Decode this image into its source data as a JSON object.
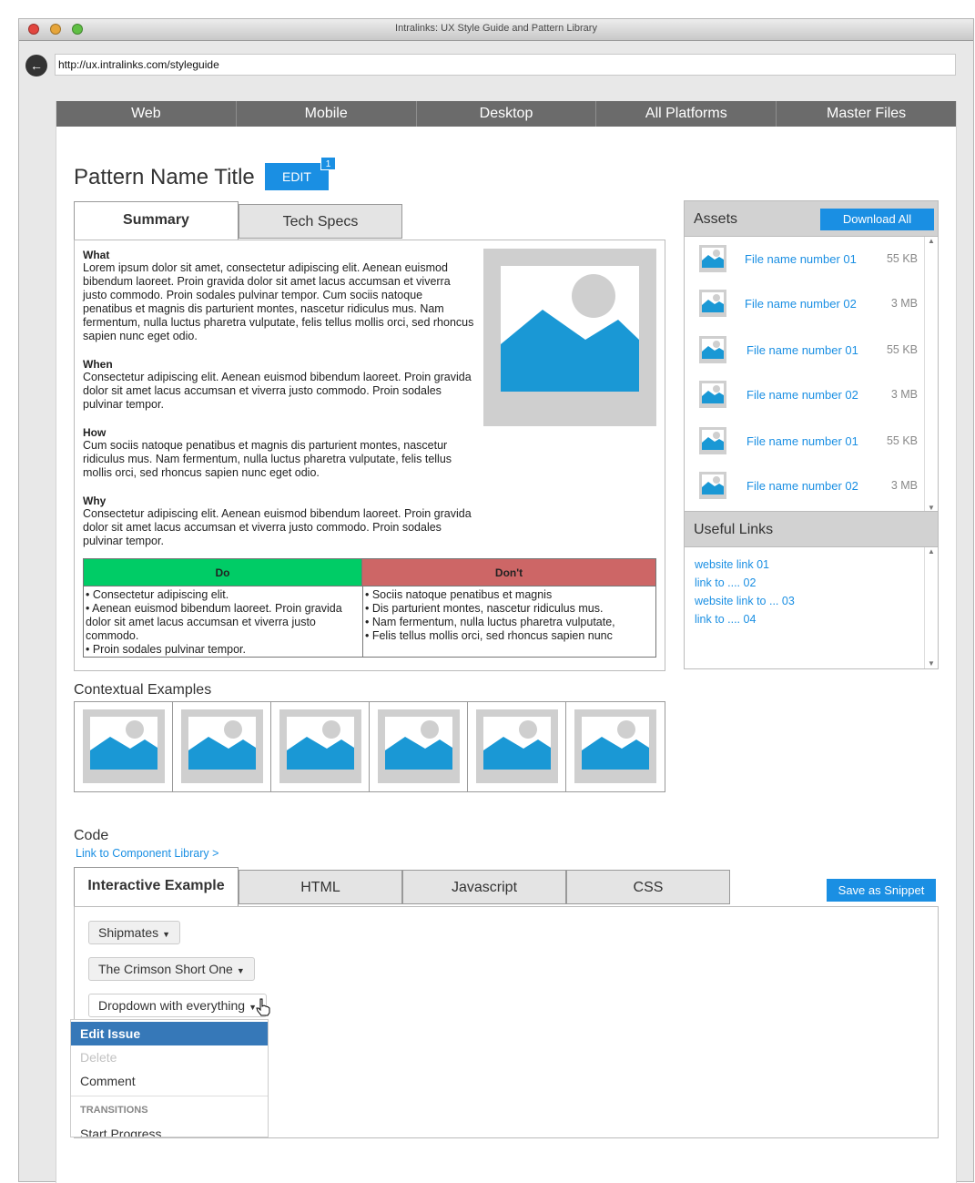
{
  "window": {
    "title": "Intralinks: UX Style Guide and Pattern Library"
  },
  "address_bar": {
    "url": "http://ux.intralinks.com/styleguide"
  },
  "platform_nav": [
    {
      "label": "Web"
    },
    {
      "label": "Mobile"
    },
    {
      "label": "Desktop"
    },
    {
      "label": "All Platforms"
    },
    {
      "label": "Master Files"
    }
  ],
  "pattern": {
    "title": "Pattern Name Title",
    "edit_label": "EDIT",
    "edit_badge": "1"
  },
  "detail_tabs": [
    {
      "label": "Summary",
      "active": true
    },
    {
      "label": "Tech Specs",
      "active": false
    }
  ],
  "summary": {
    "sections": [
      {
        "heading": "What",
        "body": "Lorem ipsum dolor sit amet, consectetur adipiscing elit. Aenean euismod bibendum laoreet. Proin gravida dolor sit amet lacus accumsan et viverra justo commodo. Proin sodales pulvinar tempor. Cum sociis natoque penatibus et magnis dis parturient montes, nascetur ridiculus mus. Nam fermentum, nulla luctus pharetra vulputate, felis tellus mollis orci, sed rhoncus sapien nunc eget odio."
      },
      {
        "heading": "When",
        "body": "Consectetur adipiscing elit. Aenean euismod bibendum laoreet. Proin gravida dolor sit amet lacus accumsan et viverra justo commodo. Proin sodales pulvinar tempor."
      },
      {
        "heading": "How",
        "body": "Cum sociis natoque penatibus et magnis dis parturient montes, nascetur ridiculus mus. Nam fermentum, nulla luctus pharetra vulputate, felis tellus mollis orci, sed rhoncus sapien nunc eget odio."
      },
      {
        "heading": "Why",
        "body": "Consectetur adipiscing elit. Aenean euismod bibendum laoreet. Proin gravida dolor sit amet lacus accumsan et viverra justo commodo. Proin sodales pulvinar tempor."
      }
    ],
    "do_dont": {
      "do_label": "Do",
      "dont_label": "Don't",
      "do_color": "#00cc66",
      "dont_color": "#cd6666",
      "do_items": [
        "• Consectetur adipiscing elit.",
        "• Aenean euismod bibendum laoreet. Proin gravida dolor sit amet lacus accumsan et viverra justo commodo.",
        "• Proin sodales pulvinar tempor."
      ],
      "dont_items": [
        "• Sociis natoque penatibus et magnis",
        "• Dis parturient montes, nascetur ridiculus mus.",
        "• Nam fermentum, nulla luctus pharetra vulputate,",
        "• Felis tellus mollis orci, sed rhoncus sapien nunc"
      ]
    }
  },
  "assets": {
    "title": "Assets",
    "download_all": "Download All",
    "files": [
      {
        "name": "File name number 01",
        "size": "55 KB"
      },
      {
        "name": "File name number 02",
        "size": "3 MB"
      },
      {
        "name": "File name number 01",
        "size": "55 KB"
      },
      {
        "name": "File name number 02",
        "size": "3 MB"
      },
      {
        "name": "File name number 01",
        "size": "55 KB"
      },
      {
        "name": "File name number 02",
        "size": "3 MB"
      }
    ]
  },
  "useful_links": {
    "title": "Useful Links",
    "links": [
      "website link 01",
      "link to .... 02",
      "website link to ... 03",
      "link to .... 04"
    ]
  },
  "contextual_examples": {
    "title": "Contextual Examples",
    "count": 6
  },
  "code": {
    "title": "Code",
    "component_link": "Link to Component Library >",
    "save_snippet": "Save as Snippet",
    "tabs": [
      {
        "label": "Interactive Example",
        "active": true
      },
      {
        "label": "HTML",
        "active": false
      },
      {
        "label": "Javascript",
        "active": false
      },
      {
        "label": "CSS",
        "active": false
      }
    ],
    "dropdowns": [
      "Shipmates",
      "The Crimson Short One",
      "Dropdown with everything"
    ],
    "menu": {
      "items": [
        {
          "label": "Edit Issue",
          "state": "selected"
        },
        {
          "label": "Delete",
          "state": "disabled"
        },
        {
          "label": "Comment",
          "state": "normal"
        }
      ],
      "group_label": "TRANSITIONS",
      "group_items": [
        "Start Progress"
      ]
    }
  },
  "colors": {
    "accent": "#1a8fe3",
    "nav_bg": "#6b6b6b",
    "menu_selected": "#3678b8",
    "image_blue": "#1a98d5",
    "image_gray": "#cfcfcf"
  },
  "icons": [
    "back-arrow-icon",
    "image-placeholder-icon",
    "caret-down-icon",
    "scroll-up-icon",
    "scroll-down-icon",
    "hand-pointer-icon"
  ]
}
